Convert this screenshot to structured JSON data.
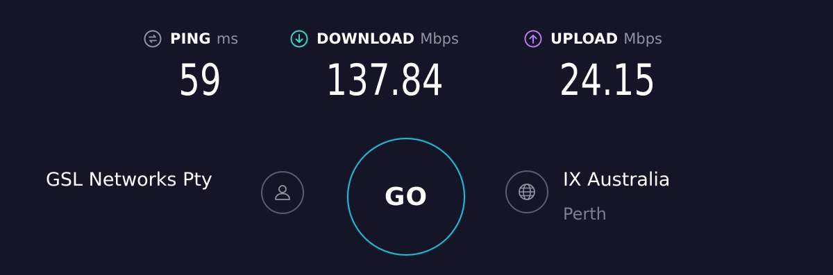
{
  "metrics": {
    "ping": {
      "label": "PING",
      "unit": "ms",
      "value": "59",
      "icon": "ping-icon"
    },
    "download": {
      "label": "DOWNLOAD",
      "unit": "Mbps",
      "value": "137.84",
      "icon": "download-arrow-icon",
      "color": "#3fd1c5"
    },
    "upload": {
      "label": "UPLOAD",
      "unit": "Mbps",
      "value": "24.15",
      "icon": "upload-arrow-icon",
      "color": "#b77cf0"
    }
  },
  "isp": {
    "name": "GSL Networks Pty",
    "icon": "user-icon"
  },
  "go_button": {
    "label": "GO",
    "ring_color": "#2bb6cf"
  },
  "server": {
    "name": "IX Australia",
    "location": "Perth",
    "icon": "globe-icon"
  },
  "colors": {
    "background": "#141526",
    "unit_text": "#9193a8",
    "muted_text": "#7b7d92"
  }
}
